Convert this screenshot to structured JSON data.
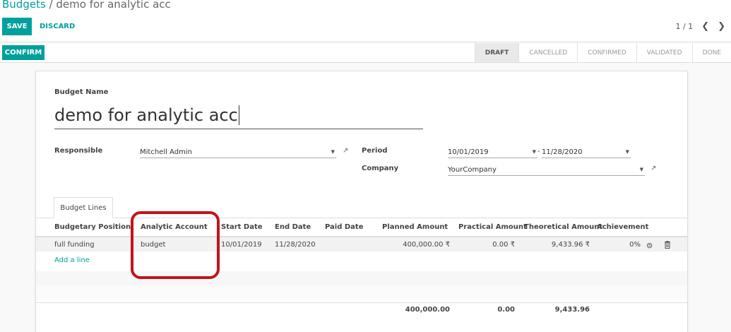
{
  "breadcrumb": {
    "parent": "Budgets",
    "separator": "/",
    "current": "demo for analytic acc"
  },
  "toolbar": {
    "save_label": "SAVE",
    "discard_label": "DISCARD"
  },
  "pager": {
    "value": "1 / 1",
    "prev_icon": "chevron-left-icon",
    "next_icon": "chevron-right-icon"
  },
  "statusbar": {
    "confirm_label": "CONFIRM",
    "stages": [
      "DRAFT",
      "CANCELLED",
      "CONFIRMED",
      "VALIDATED",
      "DONE"
    ],
    "active_stage": "DRAFT"
  },
  "form": {
    "budget_name_label": "Budget Name",
    "budget_name": "demo for analytic acc",
    "responsible_label": "Responsible",
    "responsible": "Mitchell Admin",
    "period_label": "Period",
    "period_start": "10/01/2019",
    "period_separator": "-",
    "period_end": "11/28/2020",
    "company_label": "Company",
    "company": "YourCompany"
  },
  "tabs": [
    {
      "label": "Budget Lines"
    }
  ],
  "table": {
    "headers": [
      "Budgetary Position",
      "Analytic Account",
      "Start Date",
      "End Date",
      "Paid Date",
      "Planned Amount",
      "Practical Amount",
      "Theoretical Amount",
      "Achievement"
    ],
    "rows": [
      {
        "position": "full funding",
        "account": "budget",
        "start": "10/01/2019",
        "end": "11/28/2020",
        "paid": "",
        "planned": "400,000.00 ₹",
        "practical": "0.00 ₹",
        "theoretical": "9,433.96 ₹",
        "achievement": "0%"
      }
    ],
    "add_line": "Add a line",
    "totals": {
      "planned": "400,000.00",
      "practical": "0.00",
      "theoretical": "9,433.96"
    }
  },
  "colors": {
    "accent": "#00A09D",
    "highlight": "#c0141d"
  }
}
